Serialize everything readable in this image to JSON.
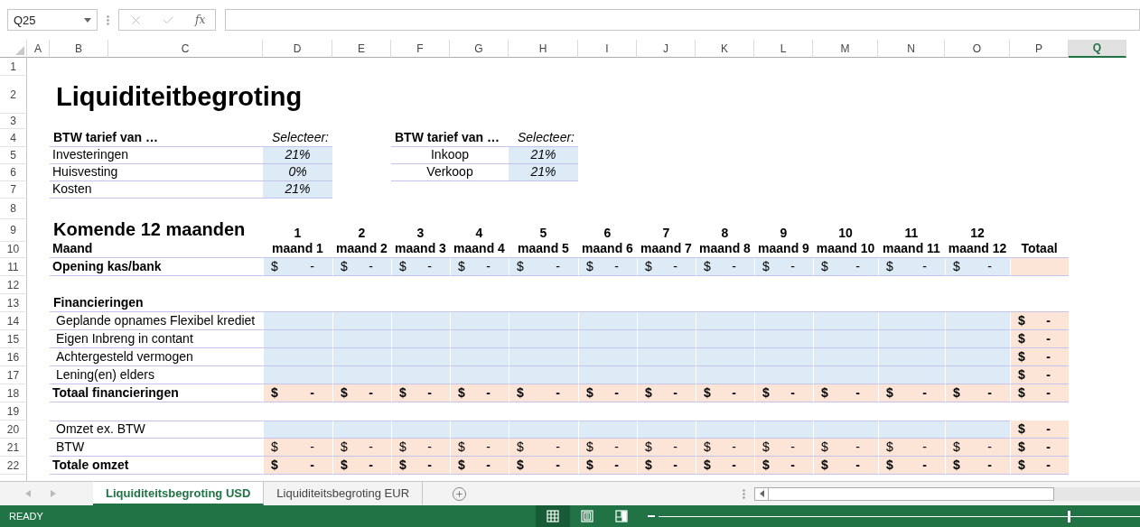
{
  "name_box": "Q25",
  "formula_button": "fx",
  "columns": [
    {
      "label": "A",
      "selected": false
    },
    {
      "label": "B",
      "selected": false
    },
    {
      "label": "C",
      "selected": false
    },
    {
      "label": "D",
      "selected": false
    },
    {
      "label": "E",
      "selected": false
    },
    {
      "label": "F",
      "selected": false
    },
    {
      "label": "G",
      "selected": false
    },
    {
      "label": "H",
      "selected": false
    },
    {
      "label": "I",
      "selected": false
    },
    {
      "label": "J",
      "selected": false
    },
    {
      "label": "K",
      "selected": false
    },
    {
      "label": "L",
      "selected": false
    },
    {
      "label": "M",
      "selected": false
    },
    {
      "label": "N",
      "selected": false
    },
    {
      "label": "O",
      "selected": false
    },
    {
      "label": "P",
      "selected": false
    },
    {
      "label": "Q",
      "selected": true
    }
  ],
  "row_numbers": [
    "1",
    "2",
    "3",
    "4",
    "5",
    "6",
    "7",
    "8",
    "9",
    "10",
    "11",
    "12",
    "13",
    "14",
    "15",
    "16",
    "17",
    "18",
    "19",
    "20",
    "21",
    "22"
  ],
  "title": "Liquiditeitbegroting",
  "vat_left": {
    "header": "BTW tarief van …",
    "select_label": "Selecteer:",
    "rows": [
      {
        "label": "Investeringen",
        "value": "21%"
      },
      {
        "label": "Huisvesting",
        "value": "0%"
      },
      {
        "label": "Kosten",
        "value": "21%"
      }
    ]
  },
  "vat_right": {
    "header": "BTW tarief van …",
    "select_label": "Selecteer:",
    "rows": [
      {
        "label": "Inkoop",
        "value": "21%"
      },
      {
        "label": "Verkoop",
        "value": "21%"
      }
    ]
  },
  "period_title": "Komende 12 maanden",
  "month_numbers": [
    "1",
    "2",
    "3",
    "4",
    "5",
    "6",
    "7",
    "8",
    "9",
    "10",
    "11",
    "12"
  ],
  "month_label": "Maand",
  "months": [
    "maand 1",
    "maand 2",
    "maand 3",
    "maand 4",
    "maand 5",
    "maand 6",
    "maand 7",
    "maand 8",
    "maand 9",
    "maand 10",
    "maand 11",
    "maand 12"
  ],
  "total_header": "Totaal",
  "body": [
    {
      "kind": "data",
      "label": "Opening kas/bank",
      "bold": true,
      "indented": false,
      "editable": true,
      "amount_bold": false,
      "cells": [
        {
          "currency": "$",
          "value": "-"
        },
        {
          "currency": "$",
          "value": "-"
        },
        {
          "currency": "$",
          "value": "-"
        },
        {
          "currency": "$",
          "value": "-"
        },
        {
          "currency": "$",
          "value": "-"
        },
        {
          "currency": "$",
          "value": "-"
        },
        {
          "currency": "$",
          "value": "-"
        },
        {
          "currency": "$",
          "value": "-"
        },
        {
          "currency": "$",
          "value": "-"
        },
        {
          "currency": "$",
          "value": "-"
        },
        {
          "currency": "$",
          "value": "-"
        },
        {
          "currency": "$",
          "value": "-"
        }
      ],
      "total": {
        "editable": false
      }
    },
    {
      "kind": "blank"
    },
    {
      "kind": "heading",
      "label": "Financieringen"
    },
    {
      "kind": "data",
      "label": "Geplande opnames Flexibel krediet",
      "bold": false,
      "indented": true,
      "editable": true,
      "total": {
        "editable": false,
        "currency": "$",
        "value": "-",
        "bold": true
      }
    },
    {
      "kind": "data",
      "label": "Eigen Inbreng in contant",
      "bold": false,
      "indented": true,
      "editable": true,
      "total": {
        "editable": false,
        "currency": "$",
        "value": "-",
        "bold": true
      }
    },
    {
      "kind": "data",
      "label": "Achtergesteld vermogen",
      "bold": false,
      "indented": true,
      "editable": true,
      "total": {
        "editable": false,
        "currency": "$",
        "value": "-",
        "bold": true
      }
    },
    {
      "kind": "data",
      "label": "Lening(en) elders",
      "bold": false,
      "indented": true,
      "editable": true,
      "total": {
        "editable": false,
        "currency": "$",
        "value": "-",
        "bold": true
      }
    },
    {
      "kind": "data",
      "label": "Totaal financieringen",
      "bold": true,
      "indented": false,
      "editable": false,
      "amount_bold": true,
      "cells": [
        {
          "currency": "$",
          "value": "-"
        },
        {
          "currency": "$",
          "value": "-"
        },
        {
          "currency": "$",
          "value": "-"
        },
        {
          "currency": "$",
          "value": "-"
        },
        {
          "currency": "$",
          "value": "-"
        },
        {
          "currency": "$",
          "value": "-"
        },
        {
          "currency": "$",
          "value": "-"
        },
        {
          "currency": "$",
          "value": "-"
        },
        {
          "currency": "$",
          "value": "-"
        },
        {
          "currency": "$",
          "value": "-"
        },
        {
          "currency": "$",
          "value": "-"
        },
        {
          "currency": "$",
          "value": "-"
        }
      ],
      "total": {
        "editable": false,
        "currency": "$",
        "value": "-",
        "bold": true
      }
    },
    {
      "kind": "blank"
    },
    {
      "kind": "data",
      "label": "Omzet ex. BTW",
      "bold": false,
      "indented": true,
      "editable": true,
      "rule_above": true,
      "total": {
        "editable": false,
        "currency": "$",
        "value": "-",
        "bold": true
      }
    },
    {
      "kind": "data",
      "label": "BTW",
      "bold": false,
      "indented": true,
      "editable": false,
      "amount_bold": false,
      "cells": [
        {
          "currency": "$",
          "value": "-"
        },
        {
          "currency": "$",
          "value": "-"
        },
        {
          "currency": "$",
          "value": "-"
        },
        {
          "currency": "$",
          "value": "-"
        },
        {
          "currency": "$",
          "value": "-"
        },
        {
          "currency": "$",
          "value": "-"
        },
        {
          "currency": "$",
          "value": "-"
        },
        {
          "currency": "$",
          "value": "-"
        },
        {
          "currency": "$",
          "value": "-"
        },
        {
          "currency": "$",
          "value": "-"
        },
        {
          "currency": "$",
          "value": "-"
        },
        {
          "currency": "$",
          "value": "-"
        }
      ],
      "total": {
        "editable": false,
        "currency": "$",
        "value": "-",
        "bold": true
      }
    },
    {
      "kind": "data",
      "label": "Totale omzet",
      "bold": true,
      "indented": false,
      "editable": false,
      "amount_bold": true,
      "cells": [
        {
          "currency": "$",
          "value": "-"
        },
        {
          "currency": "$",
          "value": "-"
        },
        {
          "currency": "$",
          "value": "-"
        },
        {
          "currency": "$",
          "value": "-"
        },
        {
          "currency": "$",
          "value": "-"
        },
        {
          "currency": "$",
          "value": "-"
        },
        {
          "currency": "$",
          "value": "-"
        },
        {
          "currency": "$",
          "value": "-"
        },
        {
          "currency": "$",
          "value": "-"
        },
        {
          "currency": "$",
          "value": "-"
        },
        {
          "currency": "$",
          "value": "-"
        },
        {
          "currency": "$",
          "value": "-"
        }
      ],
      "total": {
        "editable": false,
        "currency": "$",
        "value": "-",
        "bold": true
      }
    }
  ],
  "tabs": [
    {
      "label": "Liquiditeitsbegroting USD",
      "selected": true
    },
    {
      "label": "Liquiditeitsbegroting EUR",
      "selected": false
    }
  ],
  "status_bar": {
    "status": "READY",
    "views": [
      {
        "kind": "normal",
        "selected": true
      },
      {
        "kind": "page_layout",
        "selected": false
      },
      {
        "kind": "page_break",
        "selected": false
      }
    ],
    "zoom": {
      "level": 0.85
    }
  }
}
